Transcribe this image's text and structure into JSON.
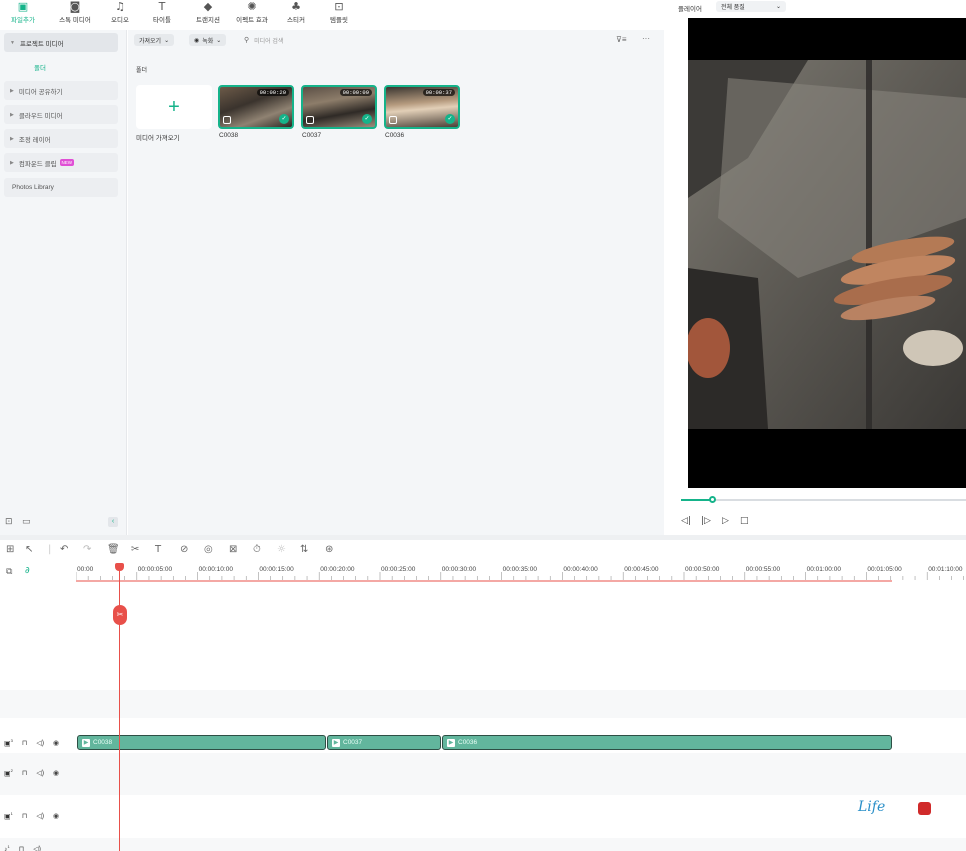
{
  "toolbar": {
    "items": [
      {
        "label": "파일추가",
        "icon": "media-icon",
        "active": true
      },
      {
        "label": "스톡 미디어",
        "icon": "stock-media-icon",
        "active": false
      },
      {
        "label": "오디오",
        "icon": "music-note-icon",
        "active": false
      },
      {
        "label": "타이틀",
        "icon": "text-t-icon",
        "active": false
      },
      {
        "label": "트랜지션",
        "icon": "transition-icon",
        "active": false
      },
      {
        "label": "이펙트 효과",
        "icon": "effects-icon",
        "active": false
      },
      {
        "label": "스티커",
        "icon": "sticker-icon",
        "active": false
      },
      {
        "label": "템플릿",
        "icon": "template-icon",
        "active": false
      }
    ]
  },
  "sidebar": {
    "project_media": "프로젝트 미디어",
    "folder": "폴더",
    "items": [
      "미디어 공유하기",
      "클라우드 미디어",
      "조정 레이어",
      "컴파운드 클립"
    ],
    "new_badge": "NEW",
    "photos_library": "Photos Library"
  },
  "media": {
    "import_dropdown": "가져오기",
    "record_dropdown": "녹화",
    "search_placeholder": "미디어 검색",
    "folder_heading": "폴더",
    "import_tile_label": "미디어 가져오기",
    "clips": [
      {
        "name": "C0038",
        "duration": "00:00:20"
      },
      {
        "name": "C0037",
        "duration": "00:00:09"
      },
      {
        "name": "C0036",
        "duration": "00:00:37"
      }
    ]
  },
  "player": {
    "label": "플레이어",
    "quality": "전체 품질",
    "progress": 0.11
  },
  "timeline": {
    "ticks": [
      "00:00",
      "00:00:05:00",
      "00:00:10:00",
      "00:00:15:00",
      "00:00:20:00",
      "00:00:25:00",
      "00:00:30:00",
      "00:00:35:00",
      "00:00:40:00",
      "00:00:45:00",
      "00:00:50:00",
      "00:00:55:00",
      "00:01:00:00",
      "00:01:05:00",
      "00:01:10:00"
    ],
    "track_numbers": [
      "3",
      "2",
      "1",
      "1"
    ],
    "clips": [
      {
        "name": "C0038"
      },
      {
        "name": "C0037"
      },
      {
        "name": "C0036"
      }
    ]
  },
  "watermark": {
    "text": "Life"
  },
  "colors": {
    "accent": "#15b38a",
    "clip": "#62b69d",
    "playhead": "#e8504a"
  }
}
